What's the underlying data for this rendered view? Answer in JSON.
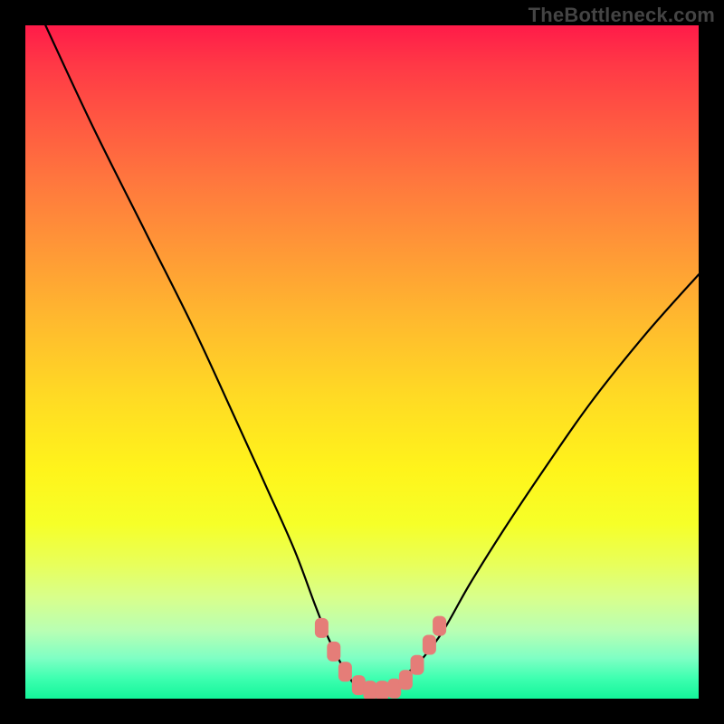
{
  "watermark": "TheBottleneck.com",
  "chart_data": {
    "type": "line",
    "title": "",
    "xlabel": "",
    "ylabel": "",
    "xlim": [
      0,
      100
    ],
    "ylim": [
      0,
      100
    ],
    "grid": false,
    "legend": false,
    "series": [
      {
        "name": "bottleneck-curve",
        "color": "#000000",
        "x": [
          3,
          10,
          18,
          25,
          31,
          36,
          40,
          43,
          45,
          47,
          49,
          51,
          53,
          55,
          57,
          59,
          62,
          66,
          71,
          77,
          84,
          92,
          100
        ],
        "y": [
          100,
          85,
          69,
          55,
          42,
          31,
          22,
          14,
          9,
          5,
          2,
          1,
          1,
          2,
          4,
          6,
          10,
          17,
          25,
          34,
          44,
          54,
          63
        ]
      }
    ],
    "annotations": [
      {
        "type": "marker-band",
        "color": "#e57d78",
        "points": [
          {
            "x": 44.0,
            "y": 10.5
          },
          {
            "x": 45.8,
            "y": 7.0
          },
          {
            "x": 47.5,
            "y": 4.0
          },
          {
            "x": 49.5,
            "y": 2.0
          },
          {
            "x": 51.2,
            "y": 1.2
          },
          {
            "x": 53.0,
            "y": 1.2
          },
          {
            "x": 54.8,
            "y": 1.5
          },
          {
            "x": 56.5,
            "y": 2.8
          },
          {
            "x": 58.2,
            "y": 5.0
          },
          {
            "x": 60.0,
            "y": 8.0
          },
          {
            "x": 61.5,
            "y": 10.8
          }
        ]
      }
    ],
    "background": {
      "type": "gradient-vertical",
      "stops": [
        {
          "pos": 0.0,
          "color": "#ff1b49"
        },
        {
          "pos": 0.5,
          "color": "#ffc82a"
        },
        {
          "pos": 0.8,
          "color": "#f0ff40"
        },
        {
          "pos": 1.0,
          "color": "#14f59a"
        }
      ]
    }
  }
}
